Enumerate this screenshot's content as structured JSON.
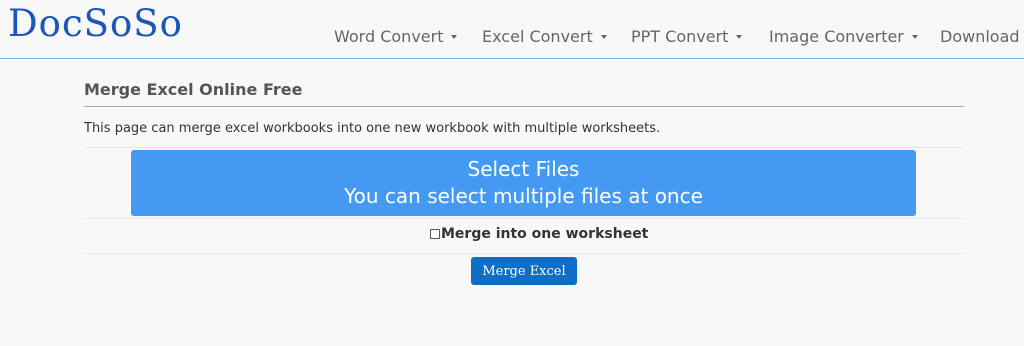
{
  "brand": {
    "logo": "DocSoSo"
  },
  "nav": {
    "items": [
      {
        "label": "Word Convert",
        "has_caret": true
      },
      {
        "label": "Excel Convert",
        "has_caret": true
      },
      {
        "label": "PPT Convert",
        "has_caret": true
      },
      {
        "label": "Image Converter",
        "has_caret": true
      },
      {
        "label": "Download",
        "has_caret": false
      }
    ]
  },
  "main": {
    "title": "Merge Excel Online Free",
    "description": "This page can merge excel workbooks into one new workbook with multiple worksheets.",
    "select_files": {
      "line1": "Select Files",
      "line2": "You can select multiple files at once"
    },
    "merge_option": {
      "label": "Merge into one worksheet",
      "checked": false
    },
    "merge_button": "Merge Excel"
  },
  "colors": {
    "logo": "#1b56b8",
    "select_button": "#4499f2",
    "merge_button": "#0f6dc6",
    "nav_border": "#7ab7e8"
  }
}
